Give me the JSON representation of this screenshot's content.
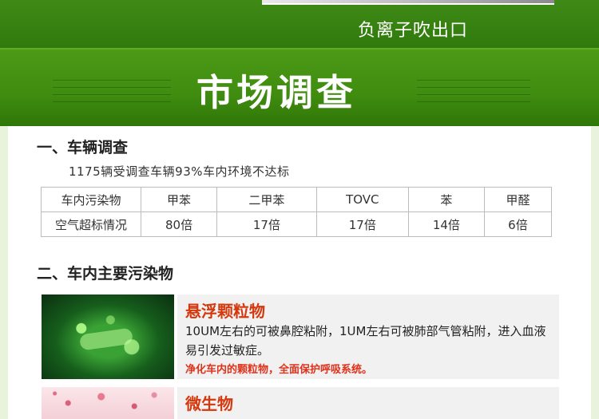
{
  "top": {
    "caption": "负离子吹出口"
  },
  "title_band": {
    "title": "市场调查"
  },
  "section1": {
    "heading": "一、车辆调查",
    "summary": "1175辆受调查车辆93%车内环境不达标",
    "table": {
      "header": [
        "车内污染物",
        "甲苯",
        "二甲苯",
        "TOVC",
        "苯",
        "甲醛"
      ],
      "row": [
        "空气超标情况",
        "80倍",
        "17倍",
        "17倍",
        "14倍",
        "6倍"
      ]
    }
  },
  "section2": {
    "heading": "二、车内主要污染物",
    "cards": [
      {
        "title": "悬浮颗粒物",
        "body": "10UM左右的可被鼻腔粘附，1UM左右可被肺部气管粘附，进入血液易引发过敏症。",
        "note": "净化车内的颗粒物，全面保护呼吸系统。"
      },
      {
        "title": "微生物"
      }
    ]
  }
}
